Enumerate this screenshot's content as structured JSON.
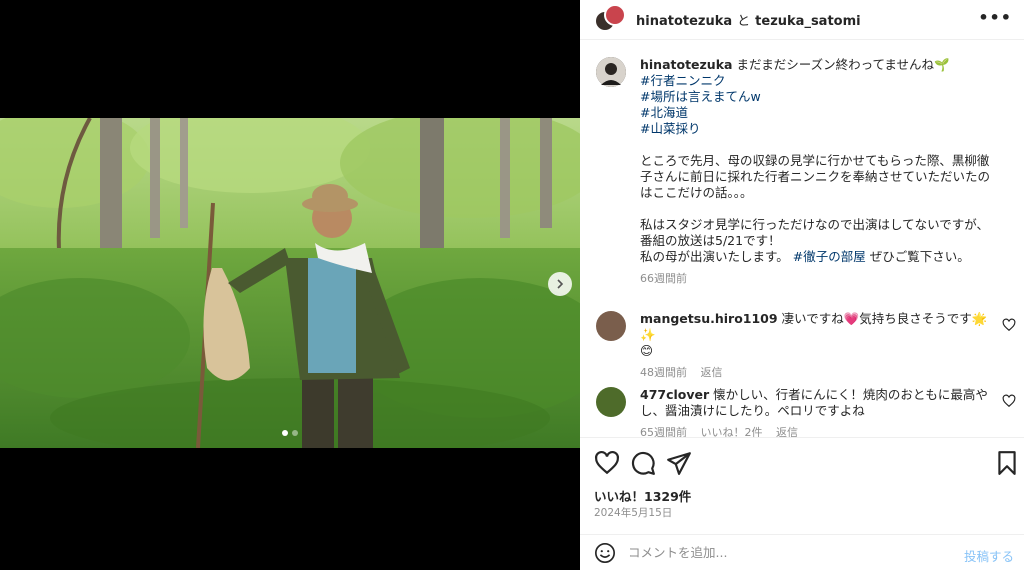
{
  "header": {
    "user1": "hinatotezuka",
    "conjunction": "と",
    "user2": "tezuka_satomi",
    "more_icon": "more-dots-icon"
  },
  "caption": {
    "username": "hinatotezuka",
    "text": "まだまだシーズン終わってませんね🌱",
    "hashtags": [
      "#行者ニンニク",
      "#場所は言えまてんw",
      "#北海道",
      "#山菜採り"
    ],
    "paragraph1": [
      "ところで先月、母の収録の見学に行かせてもらった際、黒柳徹",
      "子さんに前日に採れた行者ニンニクを奉納させていただいたの",
      "はここだけの話。。。"
    ],
    "paragraph2": [
      "私はスタジオ見学に行っただけなので出演はしてないですが、",
      "番組の放送は5/21です！"
    ],
    "last_line_pre": "私の母が出演いたします。",
    "last_line_tag": "#徹子の部屋",
    "last_line_post": "ぜひご覧下さい。",
    "time": "66週間前"
  },
  "comments": [
    {
      "username": "mangetsu.hiro1109",
      "text": "凄いですね💗気持ち良さそうです🌟✨",
      "text2": "😊",
      "time": "48週間前",
      "reply": "返信"
    },
    {
      "username": "477clover",
      "text": "懐かしい、行者にんにく！焼肉のおともに最高や",
      "text2": "し、醤油漬けにしたり。ペロリですよね",
      "time": "65週間前",
      "likes": "いいね！2件",
      "reply": "返信"
    }
  ],
  "likes_text": "いいね！1329件",
  "date_text": "2024年5月15日",
  "comment_input": {
    "placeholder": "コメントを追加...",
    "post_label": "投稿する"
  },
  "carousel": {
    "slides": 2,
    "active": 1
  },
  "colors": {
    "link": "#00376b",
    "meta": "#8e8e8e",
    "post_button": "#88c3f7"
  }
}
